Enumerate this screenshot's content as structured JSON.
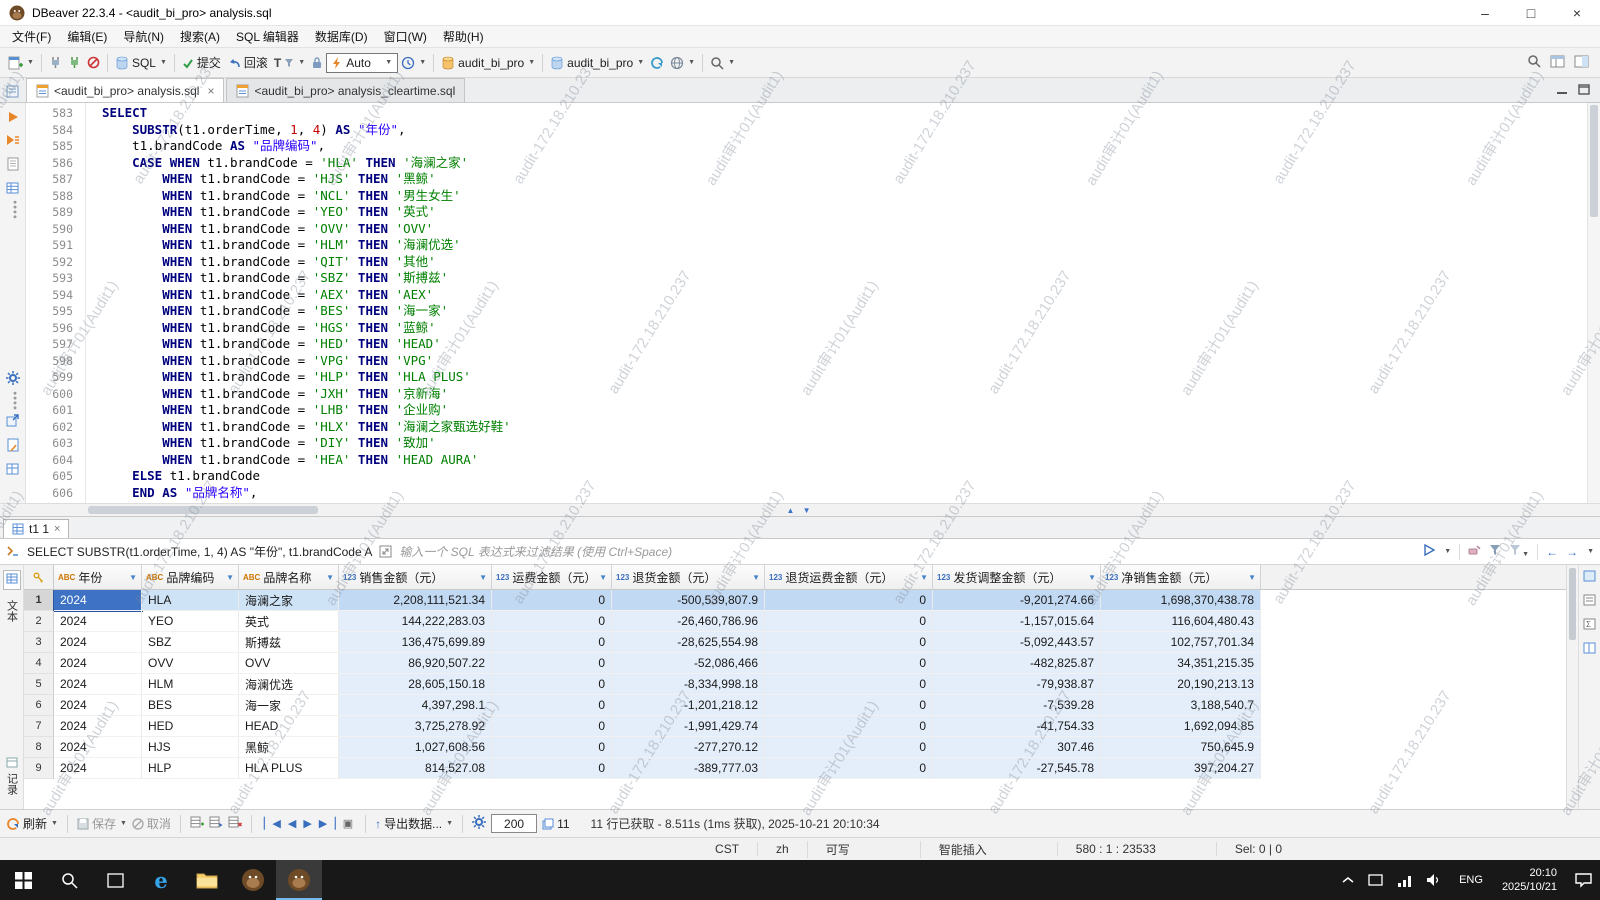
{
  "window": {
    "title": "DBeaver 22.3.4 - <audit_bi_pro> analysis.sql"
  },
  "menu": {
    "items": [
      "文件(F)",
      "编辑(E)",
      "导航(N)",
      "搜索(A)",
      "SQL 编辑器",
      "数据库(D)",
      "窗口(W)",
      "帮助(H)"
    ]
  },
  "toolbar": {
    "sql_label": "SQL",
    "commit_label": "提交",
    "rollback_label": "回滚",
    "tx_filter_label": "T",
    "tx_mode": "Auto",
    "connection": "audit_bi_pro",
    "schema": "audit_bi_pro"
  },
  "editor_tabs": [
    {
      "label": "<audit_bi_pro> analysis.sql"
    },
    {
      "label": "<audit_bi_pro> analysis_cleartime.sql"
    }
  ],
  "editor": {
    "lines": [
      {
        "n": 583,
        "t": [
          [
            "k",
            "SELECT"
          ]
        ]
      },
      {
        "n": 584,
        "t": [
          [
            "p",
            "    "
          ],
          [
            "k",
            "SUBSTR"
          ],
          [
            "p",
            "(t1.orderTime, "
          ],
          [
            "m",
            "1"
          ],
          [
            "p",
            ", "
          ],
          [
            "m",
            "4"
          ],
          [
            "p",
            ") "
          ],
          [
            "k",
            "AS"
          ],
          [
            "p",
            " "
          ],
          [
            "d",
            "\"年份\""
          ],
          [
            "p",
            ","
          ]
        ]
      },
      {
        "n": 585,
        "t": [
          [
            "p",
            "    t1.brandCode "
          ],
          [
            "k",
            "AS"
          ],
          [
            "p",
            " "
          ],
          [
            "d",
            "\"品牌编码\""
          ],
          [
            "p",
            ","
          ]
        ]
      },
      {
        "n": 586,
        "t": [
          [
            "p",
            "    "
          ],
          [
            "k",
            "CASE"
          ],
          [
            "p",
            " "
          ],
          [
            "k",
            "WHEN"
          ],
          [
            "p",
            " t1.brandCode = "
          ],
          [
            "s",
            "'HLA'"
          ],
          [
            "p",
            " "
          ],
          [
            "k",
            "THEN"
          ],
          [
            "p",
            " "
          ],
          [
            "s",
            "'海澜之家'"
          ]
        ]
      },
      {
        "n": 587,
        "t": [
          [
            "p",
            "        "
          ],
          [
            "k",
            "WHEN"
          ],
          [
            "p",
            " t1.brandCode = "
          ],
          [
            "s",
            "'HJS'"
          ],
          [
            "p",
            " "
          ],
          [
            "k",
            "THEN"
          ],
          [
            "p",
            " "
          ],
          [
            "s",
            "'黑鲸'"
          ]
        ]
      },
      {
        "n": 588,
        "t": [
          [
            "p",
            "        "
          ],
          [
            "k",
            "WHEN"
          ],
          [
            "p",
            " t1.brandCode = "
          ],
          [
            "s",
            "'NCL'"
          ],
          [
            "p",
            " "
          ],
          [
            "k",
            "THEN"
          ],
          [
            "p",
            " "
          ],
          [
            "s",
            "'男生女生'"
          ]
        ]
      },
      {
        "n": 589,
        "t": [
          [
            "p",
            "        "
          ],
          [
            "k",
            "WHEN"
          ],
          [
            "p",
            " t1.brandCode = "
          ],
          [
            "s",
            "'YEO'"
          ],
          [
            "p",
            " "
          ],
          [
            "k",
            "THEN"
          ],
          [
            "p",
            " "
          ],
          [
            "s",
            "'英式'"
          ]
        ]
      },
      {
        "n": 590,
        "t": [
          [
            "p",
            "        "
          ],
          [
            "k",
            "WHEN"
          ],
          [
            "p",
            " t1.brandCode = "
          ],
          [
            "s",
            "'OVV'"
          ],
          [
            "p",
            " "
          ],
          [
            "k",
            "THEN"
          ],
          [
            "p",
            " "
          ],
          [
            "s",
            "'OVV'"
          ]
        ]
      },
      {
        "n": 591,
        "t": [
          [
            "p",
            "        "
          ],
          [
            "k",
            "WHEN"
          ],
          [
            "p",
            " t1.brandCode = "
          ],
          [
            "s",
            "'HLM'"
          ],
          [
            "p",
            " "
          ],
          [
            "k",
            "THEN"
          ],
          [
            "p",
            " "
          ],
          [
            "s",
            "'海澜优选'"
          ]
        ]
      },
      {
        "n": 592,
        "t": [
          [
            "p",
            "        "
          ],
          [
            "k",
            "WHEN"
          ],
          [
            "p",
            " t1.brandCode = "
          ],
          [
            "s",
            "'QIT'"
          ],
          [
            "p",
            " "
          ],
          [
            "k",
            "THEN"
          ],
          [
            "p",
            " "
          ],
          [
            "s",
            "'其他'"
          ]
        ]
      },
      {
        "n": 593,
        "t": [
          [
            "p",
            "        "
          ],
          [
            "k",
            "WHEN"
          ],
          [
            "p",
            " t1.brandCode = "
          ],
          [
            "s",
            "'SBZ'"
          ],
          [
            "p",
            " "
          ],
          [
            "k",
            "THEN"
          ],
          [
            "p",
            " "
          ],
          [
            "s",
            "'斯搏兹'"
          ]
        ]
      },
      {
        "n": 594,
        "t": [
          [
            "p",
            "        "
          ],
          [
            "k",
            "WHEN"
          ],
          [
            "p",
            " t1.brandCode = "
          ],
          [
            "s",
            "'AEX'"
          ],
          [
            "p",
            " "
          ],
          [
            "k",
            "THEN"
          ],
          [
            "p",
            " "
          ],
          [
            "s",
            "'AEX'"
          ]
        ]
      },
      {
        "n": 595,
        "t": [
          [
            "p",
            "        "
          ],
          [
            "k",
            "WHEN"
          ],
          [
            "p",
            " t1.brandCode = "
          ],
          [
            "s",
            "'BES'"
          ],
          [
            "p",
            " "
          ],
          [
            "k",
            "THEN"
          ],
          [
            "p",
            " "
          ],
          [
            "s",
            "'海一家'"
          ]
        ]
      },
      {
        "n": 596,
        "t": [
          [
            "p",
            "        "
          ],
          [
            "k",
            "WHEN"
          ],
          [
            "p",
            " t1.brandCode = "
          ],
          [
            "s",
            "'HGS'"
          ],
          [
            "p",
            " "
          ],
          [
            "k",
            "THEN"
          ],
          [
            "p",
            " "
          ],
          [
            "s",
            "'蓝鲸'"
          ]
        ]
      },
      {
        "n": 597,
        "t": [
          [
            "p",
            "        "
          ],
          [
            "k",
            "WHEN"
          ],
          [
            "p",
            " t1.brandCode = "
          ],
          [
            "s",
            "'HED'"
          ],
          [
            "p",
            " "
          ],
          [
            "k",
            "THEN"
          ],
          [
            "p",
            " "
          ],
          [
            "s",
            "'HEAD'"
          ]
        ]
      },
      {
        "n": 598,
        "t": [
          [
            "p",
            "        "
          ],
          [
            "k",
            "WHEN"
          ],
          [
            "p",
            " t1.brandCode = "
          ],
          [
            "s",
            "'VPG'"
          ],
          [
            "p",
            " "
          ],
          [
            "k",
            "THEN"
          ],
          [
            "p",
            " "
          ],
          [
            "s",
            "'VPG'"
          ]
        ]
      },
      {
        "n": 599,
        "t": [
          [
            "p",
            "        "
          ],
          [
            "k",
            "WHEN"
          ],
          [
            "p",
            " t1.brandCode = "
          ],
          [
            "s",
            "'HLP'"
          ],
          [
            "p",
            " "
          ],
          [
            "k",
            "THEN"
          ],
          [
            "p",
            " "
          ],
          [
            "s",
            "'HLA PLUS'"
          ]
        ]
      },
      {
        "n": 600,
        "t": [
          [
            "p",
            "        "
          ],
          [
            "k",
            "WHEN"
          ],
          [
            "p",
            " t1.brandCode = "
          ],
          [
            "s",
            "'JXH'"
          ],
          [
            "p",
            " "
          ],
          [
            "k",
            "THEN"
          ],
          [
            "p",
            " "
          ],
          [
            "s",
            "'京新海'"
          ]
        ]
      },
      {
        "n": 601,
        "t": [
          [
            "p",
            "        "
          ],
          [
            "k",
            "WHEN"
          ],
          [
            "p",
            " t1.brandCode = "
          ],
          [
            "s",
            "'LHB'"
          ],
          [
            "p",
            " "
          ],
          [
            "k",
            "THEN"
          ],
          [
            "p",
            " "
          ],
          [
            "s",
            "'企业购'"
          ]
        ]
      },
      {
        "n": 602,
        "t": [
          [
            "p",
            "        "
          ],
          [
            "k",
            "WHEN"
          ],
          [
            "p",
            " t1.brandCode = "
          ],
          [
            "s",
            "'HLX'"
          ],
          [
            "p",
            " "
          ],
          [
            "k",
            "THEN"
          ],
          [
            "p",
            " "
          ],
          [
            "s",
            "'海澜之家甄选好鞋'"
          ]
        ]
      },
      {
        "n": 603,
        "t": [
          [
            "p",
            "        "
          ],
          [
            "k",
            "WHEN"
          ],
          [
            "p",
            " t1.brandCode = "
          ],
          [
            "s",
            "'DIY'"
          ],
          [
            "p",
            " "
          ],
          [
            "k",
            "THEN"
          ],
          [
            "p",
            " "
          ],
          [
            "s",
            "'致加'"
          ]
        ]
      },
      {
        "n": 604,
        "t": [
          [
            "p",
            "        "
          ],
          [
            "k",
            "WHEN"
          ],
          [
            "p",
            " t1.brandCode = "
          ],
          [
            "s",
            "'HEA'"
          ],
          [
            "p",
            " "
          ],
          [
            "k",
            "THEN"
          ],
          [
            "p",
            " "
          ],
          [
            "s",
            "'HEAD AURA'"
          ]
        ]
      },
      {
        "n": 605,
        "t": [
          [
            "p",
            "    "
          ],
          [
            "k",
            "ELSE"
          ],
          [
            "p",
            " t1.brandCode"
          ]
        ]
      },
      {
        "n": 606,
        "t": [
          [
            "p",
            "    "
          ],
          [
            "k",
            "END"
          ],
          [
            "p",
            " "
          ],
          [
            "k",
            "AS"
          ],
          [
            "p",
            " "
          ],
          [
            "d",
            "\"品牌名称\""
          ],
          [
            "p",
            ","
          ]
        ]
      }
    ]
  },
  "results": {
    "tab_label": "t1 1",
    "filter": {
      "query_text": "SELECT SUBSTR(t1.orderTime, 1, 4) AS \"年份\", t1.brandCode A",
      "placeholder": "输入一个 SQL 表达式来过滤结果 (使用 Ctrl+Space)"
    },
    "side_tabs": {
      "text": "文本",
      "record": "记录"
    },
    "grid": {
      "columns": [
        {
          "type": "abc",
          "label": "年份"
        },
        {
          "type": "abc",
          "label": "品牌编码"
        },
        {
          "type": "abc",
          "label": "品牌名称"
        },
        {
          "type": "123",
          "label": "销售金额（元）"
        },
        {
          "type": "123",
          "label": "运费金额（元）"
        },
        {
          "type": "123",
          "label": "退货金额（元）"
        },
        {
          "type": "123",
          "label": "退货运费金额（元）"
        },
        {
          "type": "123",
          "label": "发货调整金额（元）"
        },
        {
          "type": "123",
          "label": "净销售金额（元）"
        }
      ],
      "rows": [
        [
          "2024",
          "HLA",
          "海澜之家",
          "2,208,111,521.34",
          "0",
          "-500,539,807.9",
          "0",
          "-9,201,274.66",
          "1,698,370,438.78"
        ],
        [
          "2024",
          "YEO",
          "英式",
          "144,222,283.03",
          "0",
          "-26,460,786.96",
          "0",
          "-1,157,015.64",
          "116,604,480.43"
        ],
        [
          "2024",
          "SBZ",
          "斯搏兹",
          "136,475,699.89",
          "0",
          "-28,625,554.98",
          "0",
          "-5,092,443.57",
          "102,757,701.34"
        ],
        [
          "2024",
          "OVV",
          "OVV",
          "86,920,507.22",
          "0",
          "-52,086,466",
          "0",
          "-482,825.87",
          "34,351,215.35"
        ],
        [
          "2024",
          "HLM",
          "海澜优选",
          "28,605,150.18",
          "0",
          "-8,334,998.18",
          "0",
          "-79,938.87",
          "20,190,213.13"
        ],
        [
          "2024",
          "BES",
          "海一家",
          "4,397,298.1",
          "0",
          "-1,201,218.12",
          "0",
          "-7,539.28",
          "3,188,540.7"
        ],
        [
          "2024",
          "HED",
          "HEAD",
          "3,725,278.92",
          "0",
          "-1,991,429.74",
          "0",
          "-41,754.33",
          "1,692,094.85"
        ],
        [
          "2024",
          "HJS",
          "黑鲸",
          "1,027,608.56",
          "0",
          "-277,270.12",
          "0",
          "307.46",
          "750,645.9"
        ],
        [
          "2024",
          "HLP",
          "HLA PLUS",
          "814,527.08",
          "0",
          "-389,777.03",
          "0",
          "-27,545.78",
          "397,204.27"
        ]
      ]
    },
    "toolbar": {
      "refresh": "刷新",
      "save": "保存",
      "cancel": "取消",
      "export": "导出数据...",
      "fetch_size": "200",
      "fetch_count": "11",
      "status": "11 行已获取 - 8.511s (1ms 获取), 2025-10-21 20:10:34"
    }
  },
  "statusbar": {
    "items": [
      "CST",
      "zh",
      "可写",
      "智能插入",
      "580 : 1 : 23533",
      "Sel: 0 | 0"
    ]
  },
  "taskbar": {
    "lang": "ENG",
    "time": "20:10",
    "date": "2025/10/21"
  },
  "watermark": {
    "texts": [
      "audit审计01(Audit1)",
      "audit-172.18.210.237"
    ]
  }
}
